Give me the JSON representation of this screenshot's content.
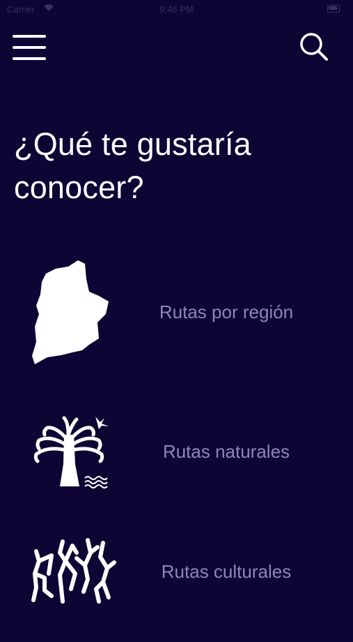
{
  "status_bar": {
    "carrier": "Carrier",
    "time": "9:46 PM"
  },
  "header": {
    "menu_icon": "hamburger-menu-icon",
    "search_icon": "search-icon"
  },
  "title": "¿Qué te gustaría conocer?",
  "routes": [
    {
      "label": "Rutas por región",
      "icon": "region-map-icon"
    },
    {
      "label": "Rutas naturales",
      "icon": "araucaria-tree-icon"
    },
    {
      "label": "Rutas culturales",
      "icon": "petroglyph-figures-icon"
    }
  ],
  "colors": {
    "background": "#0f0535",
    "label": "#8f86b8",
    "foreground": "#ffffff"
  }
}
